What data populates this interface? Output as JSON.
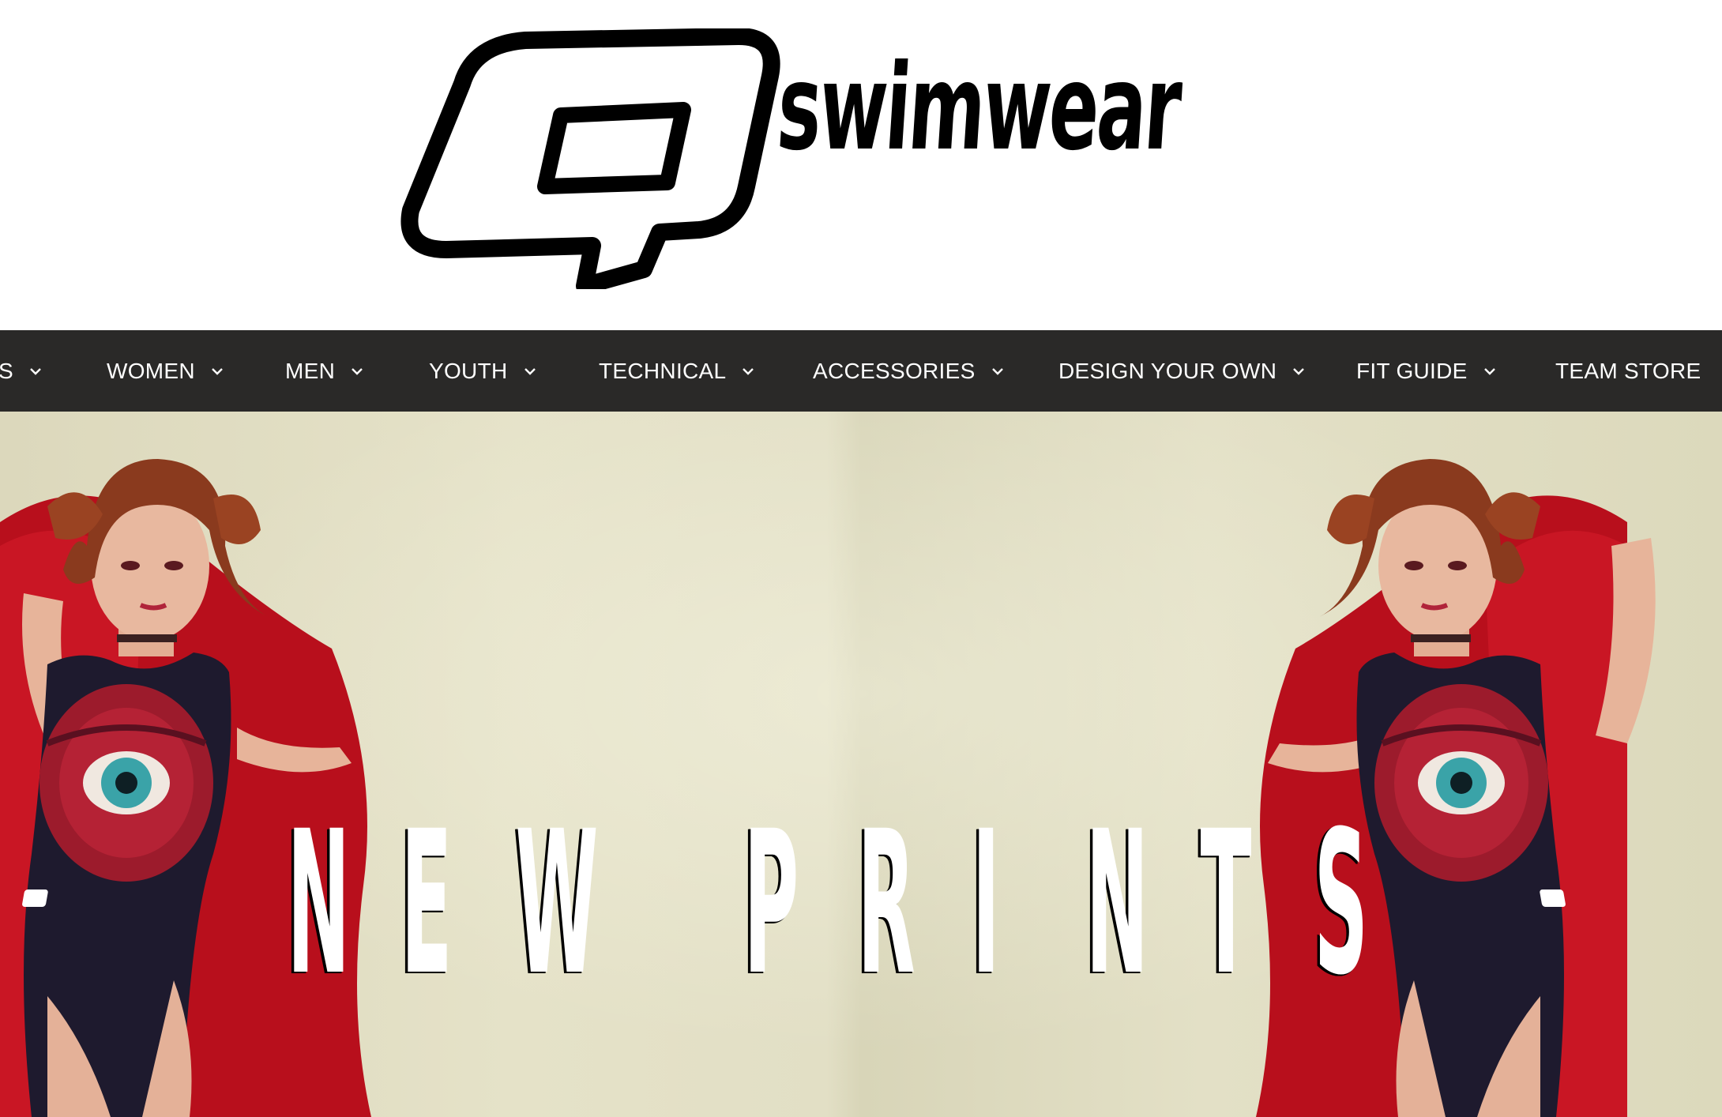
{
  "brand": {
    "name": "swimwear",
    "logo_icon": "q-speech-bubble-logo"
  },
  "nav": {
    "items": [
      {
        "label": "S",
        "has_dropdown": true
      },
      {
        "label": "WOMEN",
        "has_dropdown": true
      },
      {
        "label": "MEN",
        "has_dropdown": true
      },
      {
        "label": "YOUTH",
        "has_dropdown": true
      },
      {
        "label": "TECHNICAL",
        "has_dropdown": true
      },
      {
        "label": "ACCESSORIES",
        "has_dropdown": true
      },
      {
        "label": "DESIGN YOUR OWN",
        "has_dropdown": true
      },
      {
        "label": "FIT GUIDE",
        "has_dropdown": true
      },
      {
        "label": "TEAM STORE",
        "has_dropdown": false
      }
    ],
    "background": "#2a2928",
    "text_color": "#ffffff",
    "dropdown_icon": "chevron-down-icon"
  },
  "hero": {
    "title": "NEW PRINTS",
    "letters": [
      "N",
      "E",
      "W",
      "",
      "P",
      "R",
      "I",
      "N",
      "T",
      "S"
    ],
    "background": "#e2dfc5",
    "accent_red": "#c0121f"
  }
}
